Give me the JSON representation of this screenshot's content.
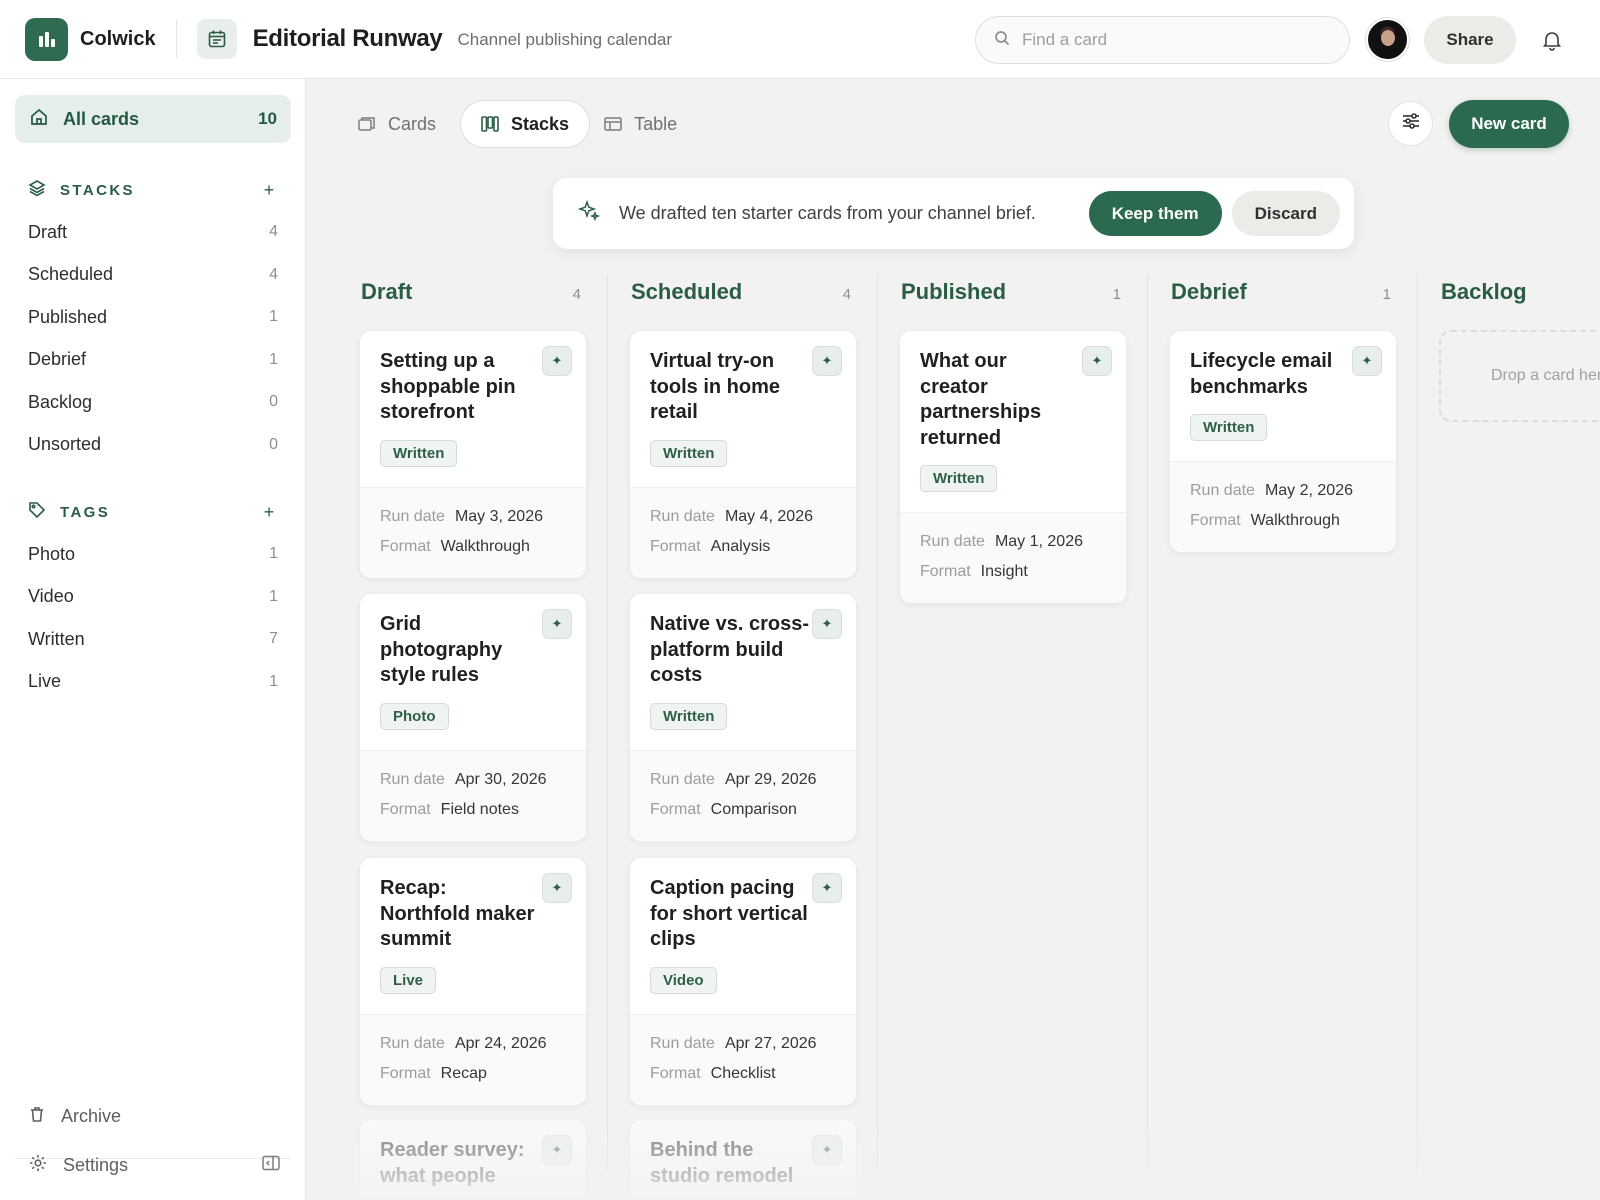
{
  "app": {
    "name": "Colwick"
  },
  "header": {
    "title": "Editorial Runway",
    "subtitle": "Channel publishing calendar",
    "search_placeholder": "Find a card",
    "share_label": "Share"
  },
  "sidebar": {
    "all_cards": {
      "label": "All cards",
      "count": "10"
    },
    "stacks_heading": "STACKS",
    "stacks": [
      {
        "label": "Draft",
        "count": "4"
      },
      {
        "label": "Scheduled",
        "count": "4"
      },
      {
        "label": "Published",
        "count": "1"
      },
      {
        "label": "Debrief",
        "count": "1"
      },
      {
        "label": "Backlog",
        "count": "0"
      },
      {
        "label": "Unsorted",
        "count": "0"
      }
    ],
    "tags_heading": "TAGS",
    "tags": [
      {
        "label": "Photo",
        "count": "1"
      },
      {
        "label": "Video",
        "count": "1"
      },
      {
        "label": "Written",
        "count": "7"
      },
      {
        "label": "Live",
        "count": "1"
      }
    ],
    "archive_label": "Archive",
    "settings_label": "Settings"
  },
  "view_tabs": [
    {
      "label": "Cards",
      "icon": "cards-icon",
      "active": false
    },
    {
      "label": "Stacks",
      "icon": "stacks-icon",
      "active": true
    },
    {
      "label": "Table",
      "icon": "table-icon",
      "active": false
    }
  ],
  "new_card_label": "New card",
  "banner": {
    "message": "We drafted ten starter cards from your channel brief.",
    "keep_label": "Keep them",
    "discard_label": "Discard"
  },
  "field_labels": {
    "run_date": "Run date",
    "format": "Format"
  },
  "columns": [
    {
      "name": "Draft",
      "count": "4",
      "cards": [
        {
          "title": "Setting up a shoppable pin storefront",
          "tag": "Written",
          "run_date": "May 3, 2026",
          "format": "Walkthrough"
        },
        {
          "title": "Grid photography style rules",
          "tag": "Photo",
          "run_date": "Apr 30, 2026",
          "format": "Field notes"
        },
        {
          "title": "Recap: Northfold maker summit",
          "tag": "Live",
          "run_date": "Apr 24, 2026",
          "format": "Recap"
        },
        {
          "title": "Reader survey: what people",
          "tag": "",
          "run_date": "",
          "format": ""
        }
      ]
    },
    {
      "name": "Scheduled",
      "count": "4",
      "cards": [
        {
          "title": "Virtual try-on tools in home retail",
          "tag": "Written",
          "run_date": "May 4, 2026",
          "format": "Analysis"
        },
        {
          "title": "Native vs. cross-platform build costs",
          "tag": "Written",
          "run_date": "Apr 29, 2026",
          "format": "Comparison"
        },
        {
          "title": "Caption pacing for short vertical clips",
          "tag": "Video",
          "run_date": "Apr 27, 2026",
          "format": "Checklist"
        },
        {
          "title": "Behind the studio remodel",
          "tag": "",
          "run_date": "",
          "format": ""
        }
      ]
    },
    {
      "name": "Published",
      "count": "1",
      "cards": [
        {
          "title": "What our creator partnerships returned",
          "tag": "Written",
          "run_date": "May 1, 2026",
          "format": "Insight"
        }
      ]
    },
    {
      "name": "Debrief",
      "count": "1",
      "cards": [
        {
          "title": "Lifecycle email benchmarks",
          "tag": "Written",
          "run_date": "May 2, 2026",
          "format": "Walkthrough"
        }
      ]
    },
    {
      "name": "Backlog",
      "count": "",
      "cards": [],
      "empty_text": "Drop a card here"
    }
  ],
  "colors": {
    "accent": "#2c6a4f",
    "accent_soft": "#e6eeea",
    "page_bg": "#f2f2f0"
  }
}
